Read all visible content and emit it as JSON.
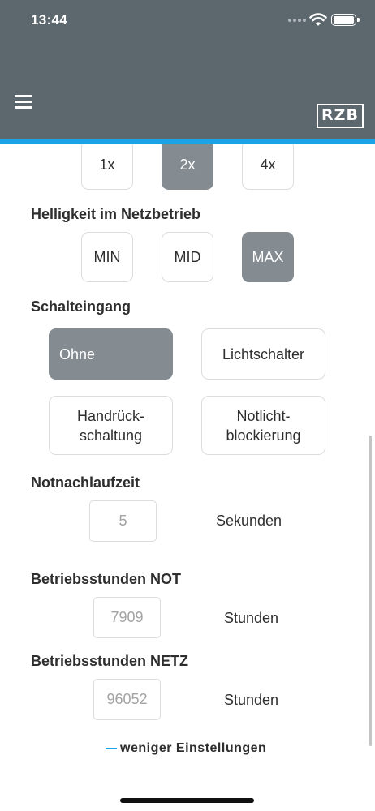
{
  "status_bar": {
    "time": "13:44"
  },
  "header": {
    "logo_text": "RZB",
    "accent_color": "#1ba3e8",
    "bar_color": "#5c676e"
  },
  "blink": {
    "options": [
      "1x",
      "2x",
      "4x"
    ],
    "selected": "2x"
  },
  "brightness": {
    "title": "Helligkeit im Netzbetrieb",
    "options": [
      "MIN",
      "MID",
      "MAX"
    ],
    "selected": "MAX"
  },
  "switch_input": {
    "title": "Schalteingang",
    "options": {
      "none": "Ohne",
      "light_switch": "Lichtschalter",
      "manual_reset_1": "Handrück-",
      "manual_reset_2": "schaltung",
      "emergency_block_1": "Notlicht-",
      "emergency_block_2": "blockierung"
    },
    "selected": "Ohne"
  },
  "run_on_time": {
    "title": "Notnachlaufzeit",
    "value": "5",
    "unit": "Sekunden"
  },
  "hours_not": {
    "title": "Betriebsstunden NOT",
    "value": "7909",
    "unit": "Stunden"
  },
  "hours_netz": {
    "title": "Betriebsstunden NETZ",
    "value": "96052",
    "unit": "Stunden"
  },
  "footer": {
    "less_settings": "weniger Einstellungen"
  },
  "colors": {
    "selected_button": "#848c92",
    "border": "#dcdcdc"
  }
}
